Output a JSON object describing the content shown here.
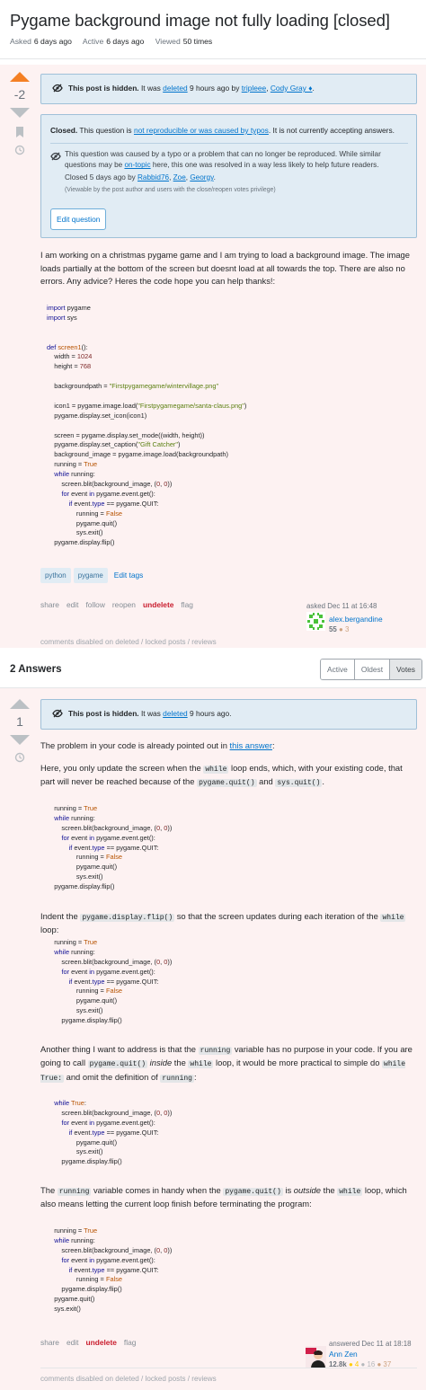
{
  "question": {
    "title": "Pygame background image not fully loading [closed]",
    "meta": {
      "asked_label": "Asked",
      "asked_value": "6 days ago",
      "active_label": "Active",
      "active_value": "6 days ago",
      "viewed_label": "Viewed",
      "viewed_value": "50 times"
    },
    "vote_count": "-2",
    "hidden_notice": {
      "bold": "This post is hidden.",
      "text": " It was ",
      "deleted_link": "deleted",
      "tail": " 9 hours ago by ",
      "user1": "tripleee",
      "sep": ", ",
      "user2": "Cody Gray ♦",
      "end": "."
    },
    "closed": {
      "bold": "Closed.",
      "text1": " This question is ",
      "reason_link": "not reproducible or was caused by typos",
      "text2": ". It is not currently accepting answers.",
      "reason_a": "This question was caused by a typo or a problem that can no longer be reproduced. While similar questions may be ",
      "ontopic_link": "on-topic",
      "reason_b": " here, this one was resolved in a way less likely to help future readers.",
      "closed_by_text": "Closed 5 days ago by ",
      "closer1": "Rabbid76",
      "closer2": "Zoe",
      "closer3": "Georgy",
      "closed_sep": ", ",
      "closed_end": ".",
      "privilege_note": "(Viewable by the post author and users with the close/reopen votes privilege)",
      "edit_button": "Edit question"
    },
    "body": "I am working on a christmas pygame game and I am trying to load a background image. The image loads partially at the bottom of the screen but doesnt load at all towards the top. There are also no errors. Any advice? Heres the code hope you can help thanks!:",
    "code_lines": [
      [
        [
          "kw",
          "import"
        ],
        [
          "plain",
          " pygame"
        ]
      ],
      [
        [
          "kw",
          "import"
        ],
        [
          "plain",
          " sys"
        ]
      ],
      [],
      [],
      [
        [
          "kw",
          "def"
        ],
        [
          "plain",
          " "
        ],
        [
          "lit",
          "screen1"
        ],
        [
          "plain",
          "():"
        ]
      ],
      [
        [
          "plain",
          "    width = "
        ],
        [
          "num",
          "1024"
        ]
      ],
      [
        [
          "plain",
          "    height = "
        ],
        [
          "num",
          "768"
        ]
      ],
      [],
      [
        [
          "plain",
          "    backgroundpath = "
        ],
        [
          "str2",
          "\"Firstpygamegame/wintervillage.png\""
        ]
      ],
      [],
      [
        [
          "plain",
          "    icon1 = pygame.image.load("
        ],
        [
          "str2",
          "\"Firstpygamegame/santa-claus.png\""
        ],
        [
          "plain",
          ")"
        ]
      ],
      [
        [
          "plain",
          "    pygame.display.set_icon(icon1)"
        ]
      ],
      [],
      [
        [
          "plain",
          "    screen = pygame.display.set_mode((width, height))"
        ]
      ],
      [
        [
          "plain",
          "    pygame.display.set_caption("
        ],
        [
          "str2",
          "\"Gift Catcher\""
        ],
        [
          "plain",
          ")"
        ]
      ],
      [
        [
          "plain",
          "    background_image = pygame.image.load(backgroundpath)"
        ]
      ],
      [
        [
          "plain",
          "    running = "
        ],
        [
          "lit",
          "True"
        ]
      ],
      [
        [
          "plain",
          "    "
        ],
        [
          "kw",
          "while"
        ],
        [
          "plain",
          " running:"
        ]
      ],
      [
        [
          "plain",
          "        screen.blit(background_image, ("
        ],
        [
          "num",
          "0"
        ],
        [
          "plain",
          ", "
        ],
        [
          "num",
          "0"
        ],
        [
          "plain",
          "))"
        ]
      ],
      [
        [
          "plain",
          "        "
        ],
        [
          "kw",
          "for"
        ],
        [
          "plain",
          " event "
        ],
        [
          "kw",
          "in"
        ],
        [
          "plain",
          " pygame.event.get():"
        ]
      ],
      [
        [
          "plain",
          "            "
        ],
        [
          "kw",
          "if"
        ],
        [
          "plain",
          " event."
        ],
        [
          "kw",
          "type"
        ],
        [
          "plain",
          " == pygame.QUIT:"
        ]
      ],
      [
        [
          "plain",
          "                running = "
        ],
        [
          "lit",
          "False"
        ]
      ],
      [
        [
          "plain",
          "                pygame.quit()"
        ]
      ],
      [
        [
          "plain",
          "                sys.exit()"
        ]
      ],
      [
        [
          "plain",
          "    pygame.display.flip()"
        ]
      ]
    ],
    "tags": [
      "python",
      "pygame"
    ],
    "edit_tags": "Edit tags",
    "menu": {
      "share": "share",
      "edit": "edit",
      "follow": "follow",
      "reopen": "reopen",
      "undelete": "undelete",
      "flag": "flag"
    },
    "asked": "asked Dec 11 at 16:48",
    "user": {
      "name": "alex.bergandine",
      "rep": "55",
      "bronze": "● 3"
    },
    "comments_disabled": "comments disabled on deleted / locked posts / reviews"
  },
  "answers_header": {
    "count": "2 Answers",
    "tabs": [
      "Active",
      "Oldest",
      "Votes"
    ]
  },
  "answer": {
    "vote_count": "1",
    "hidden_notice": {
      "bold": "This post is hidden.",
      "text": " It was ",
      "deleted_link": "deleted",
      "tail": " 9 hours ago."
    },
    "p1_text": "The problem in your code is already pointed out in ",
    "p1_link": "this answer",
    "p1_end": ":",
    "p2_a": "Here, you only update the screen when the ",
    "p2_code1": "while",
    "p2_b": " loop ends, which, with your existing code, that part will never be reached because of the ",
    "p2_code2": "pygame.quit()",
    "p2_c": " and ",
    "p2_code3": "sys.quit()",
    "p2_d": ".",
    "code1": [
      [
        [
          "plain",
          "    running = "
        ],
        [
          "lit",
          "True"
        ]
      ],
      [
        [
          "plain",
          "    "
        ],
        [
          "kw",
          "while"
        ],
        [
          "plain",
          " running:"
        ]
      ],
      [
        [
          "plain",
          "        screen.blit(background_image, ("
        ],
        [
          "num",
          "0"
        ],
        [
          "plain",
          ", "
        ],
        [
          "num",
          "0"
        ],
        [
          "plain",
          "))"
        ]
      ],
      [
        [
          "plain",
          "        "
        ],
        [
          "kw",
          "for"
        ],
        [
          "plain",
          " event "
        ],
        [
          "kw",
          "in"
        ],
        [
          "plain",
          " pygame.event.get():"
        ]
      ],
      [
        [
          "plain",
          "            "
        ],
        [
          "kw",
          "if"
        ],
        [
          "plain",
          " event."
        ],
        [
          "kw",
          "type"
        ],
        [
          "plain",
          " == pygame.QUIT:"
        ]
      ],
      [
        [
          "plain",
          "                running = "
        ],
        [
          "lit",
          "False"
        ]
      ],
      [
        [
          "plain",
          "                pygame.quit()"
        ]
      ],
      [
        [
          "plain",
          "                sys.exit()"
        ]
      ],
      [
        [
          "plain",
          "    pygame.display.flip()"
        ]
      ]
    ],
    "p3_a": "Indent the ",
    "p3_code": "pygame.display.flip()",
    "p3_b": " so that the screen updates during each iteration of the ",
    "p3_code2": "while",
    "p3_c": " loop:",
    "code2": [
      [
        [
          "plain",
          "    running = "
        ],
        [
          "lit",
          "True"
        ]
      ],
      [
        [
          "plain",
          "    "
        ],
        [
          "kw",
          "while"
        ],
        [
          "plain",
          " running:"
        ]
      ],
      [
        [
          "plain",
          "        screen.blit(background_image, ("
        ],
        [
          "num",
          "0"
        ],
        [
          "plain",
          ", "
        ],
        [
          "num",
          "0"
        ],
        [
          "plain",
          "))"
        ]
      ],
      [
        [
          "plain",
          "        "
        ],
        [
          "kw",
          "for"
        ],
        [
          "plain",
          " event "
        ],
        [
          "kw",
          "in"
        ],
        [
          "plain",
          " pygame.event.get():"
        ]
      ],
      [
        [
          "plain",
          "            "
        ],
        [
          "kw",
          "if"
        ],
        [
          "plain",
          " event."
        ],
        [
          "kw",
          "type"
        ],
        [
          "plain",
          " == pygame.QUIT:"
        ]
      ],
      [
        [
          "plain",
          "                running = "
        ],
        [
          "lit",
          "False"
        ]
      ],
      [
        [
          "plain",
          "                pygame.quit()"
        ]
      ],
      [
        [
          "plain",
          "                sys.exit()"
        ]
      ],
      [
        [
          "plain",
          "        pygame.display.flip()"
        ]
      ]
    ],
    "p4_a": "Another thing I want to address is that the ",
    "p4_code1": "running",
    "p4_b": " variable has no purpose in your code. If you are going to call ",
    "p4_code2": "pygame.quit()",
    "p4_c": " ",
    "p4_em": "inside",
    "p4_d": " the ",
    "p4_code3": "while",
    "p4_e": " loop, it would be more practical to simple do ",
    "p4_code4": "while True:",
    "p4_f": " and omit the definition of ",
    "p4_code5": "running",
    "p4_g": ":",
    "code3": [
      [
        [
          "plain",
          "    "
        ],
        [
          "kw",
          "while"
        ],
        [
          "plain",
          " "
        ],
        [
          "lit",
          "True"
        ],
        [
          "plain",
          ":"
        ]
      ],
      [
        [
          "plain",
          "        screen.blit(background_image, ("
        ],
        [
          "num",
          "0"
        ],
        [
          "plain",
          ", "
        ],
        [
          "num",
          "0"
        ],
        [
          "plain",
          "))"
        ]
      ],
      [
        [
          "plain",
          "        "
        ],
        [
          "kw",
          "for"
        ],
        [
          "plain",
          " event "
        ],
        [
          "kw",
          "in"
        ],
        [
          "plain",
          " pygame.event.get():"
        ]
      ],
      [
        [
          "plain",
          "            "
        ],
        [
          "kw",
          "if"
        ],
        [
          "plain",
          " event."
        ],
        [
          "kw",
          "type"
        ],
        [
          "plain",
          " == pygame.QUIT:"
        ]
      ],
      [
        [
          "plain",
          "                pygame.quit()"
        ]
      ],
      [
        [
          "plain",
          "                sys.exit()"
        ]
      ],
      [
        [
          "plain",
          "        pygame.display.flip()"
        ]
      ]
    ],
    "p5_a": "The ",
    "p5_code1": "running",
    "p5_b": " variable comes in handy when the ",
    "p5_code2": "pygame.quit()",
    "p5_c": " is ",
    "p5_em": "outside",
    "p5_d": " the ",
    "p5_code3": "while",
    "p5_e": " loop, which also means letting the current loop finish before terminating the program:",
    "code4": [
      [
        [
          "plain",
          "    running = "
        ],
        [
          "lit",
          "True"
        ]
      ],
      [
        [
          "plain",
          "    "
        ],
        [
          "kw",
          "while"
        ],
        [
          "plain",
          " running:"
        ]
      ],
      [
        [
          "plain",
          "        screen.blit(background_image, ("
        ],
        [
          "num",
          "0"
        ],
        [
          "plain",
          ", "
        ],
        [
          "num",
          "0"
        ],
        [
          "plain",
          "))"
        ]
      ],
      [
        [
          "plain",
          "        "
        ],
        [
          "kw",
          "for"
        ],
        [
          "plain",
          " event "
        ],
        [
          "kw",
          "in"
        ],
        [
          "plain",
          " pygame.event.get():"
        ]
      ],
      [
        [
          "plain",
          "            "
        ],
        [
          "kw",
          "if"
        ],
        [
          "plain",
          " event."
        ],
        [
          "kw",
          "type"
        ],
        [
          "plain",
          " == pygame.QUIT:"
        ]
      ],
      [
        [
          "plain",
          "                running = "
        ],
        [
          "lit",
          "False"
        ]
      ],
      [
        [
          "plain",
          "        pygame.display.flip()"
        ]
      ],
      [
        [
          "plain",
          "    pygame.quit()"
        ]
      ],
      [
        [
          "plain",
          "    sys.exit()"
        ]
      ]
    ],
    "menu": {
      "share": "share",
      "edit": "edit",
      "undelete": "undelete",
      "flag": "flag"
    },
    "answered": "answered Dec 11 at 18:18",
    "user": {
      "name": "Ann Zen",
      "rep": "12.8k",
      "gold": "● 4",
      "silver": "● 16",
      "bronze": "● 37"
    },
    "comments_disabled": "comments disabled on deleted / locked posts / reviews"
  },
  "colors": {
    "post_background": "#fdf2f2",
    "notice_background": "#e1ecf4",
    "link": "#0074cc",
    "undelete": "#c91d2e",
    "upvote_active": "#f48024"
  }
}
